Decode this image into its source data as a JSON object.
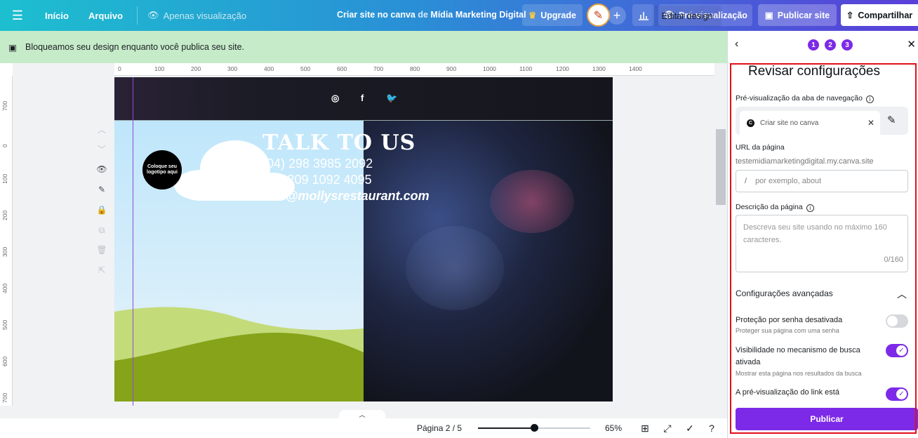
{
  "topbar": {
    "home": "Início",
    "file": "Arquivo",
    "view_mode": "Apenas visualização",
    "doc_title": "Criar site no canva",
    "doc_title_sep": "de",
    "team": "Mídia Marketing Digital",
    "upgrade": "Upgrade",
    "preview": "Pré-visualização",
    "publish_site": "Publicar site",
    "share": "Compartilhar"
  },
  "banner": {
    "message": "Bloqueamos seu design enquanto você publica seu site.",
    "edit_button": "Editar design"
  },
  "ruler": {
    "top": [
      "0",
      "100",
      "200",
      "300",
      "400",
      "500",
      "600",
      "700",
      "800",
      "900",
      "1000",
      "1100",
      "1200",
      "1300",
      "1400"
    ],
    "left": [
      "700",
      "0",
      "100",
      "200",
      "300",
      "400",
      "500",
      "600",
      "700"
    ]
  },
  "canvas": {
    "logo_text": "Coloque seu logotipo aqui",
    "heading": "TALK TO US",
    "phone1": "(04) 298 3985 2092",
    "phone2": "+76 209 1092 4095",
    "email": "info@mollysrestaurant.com"
  },
  "bottombar": {
    "page_info": "Página 2 / 5",
    "zoom": "65%",
    "zoom_fraction": 0.5
  },
  "panel": {
    "steps": [
      "1",
      "2",
      "3"
    ],
    "title": "Revisar configurações",
    "tab_preview_label": "Pré-visualização da aba de navegação",
    "tab_name": "Criar site no canva",
    "url_label": "URL da página",
    "url_domain": "testemidiamarketingdigital.my.canva.site",
    "url_prefix": "/",
    "url_placeholder": "por exemplo, about",
    "desc_label": "Descrição da página",
    "desc_placeholder": "Descreva seu site usando no máximo 160 caracteres.",
    "desc_count": "0/160",
    "advanced": "Configurações avançadas",
    "options": [
      {
        "title": "Proteção por senha desativada",
        "subtitle": "Proteger sua página com uma senha",
        "on": false
      },
      {
        "title": "Visibilidade no mecanismo de busca ativada",
        "subtitle": "Mostrar esta página nos resultados da busca",
        "on": true
      },
      {
        "title": "A pré-visualização do link está",
        "subtitle": "",
        "on": true
      }
    ],
    "publish": "Publicar"
  },
  "colors": {
    "accent": "#7d2ae8",
    "banner": "#c6ebc9",
    "highlight": "#e0101a"
  }
}
